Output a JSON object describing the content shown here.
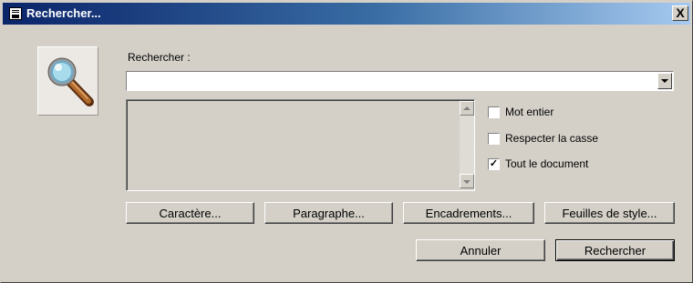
{
  "window": {
    "title": "Rechercher..."
  },
  "titlebar": {
    "close_glyph": "X"
  },
  "search": {
    "label": "Rechercher :",
    "value": "",
    "placeholder": ""
  },
  "options": [
    {
      "label": "Mot entier",
      "checked": false
    },
    {
      "label": "Respecter la casse",
      "checked": false
    },
    {
      "label": "Tout le document",
      "checked": true
    }
  ],
  "format_buttons": {
    "character": "Caractère...",
    "paragraph": "Paragraphe...",
    "frames": "Encadrements...",
    "style_sheets": "Feuilles de style..."
  },
  "actions": {
    "cancel": "Annuler",
    "search": "Rechercher"
  },
  "check_glyph": "✓",
  "icons": {
    "app": "document-app-icon",
    "search": "magnifying-glass-icon",
    "dropdown": "triangle-down-icon"
  }
}
